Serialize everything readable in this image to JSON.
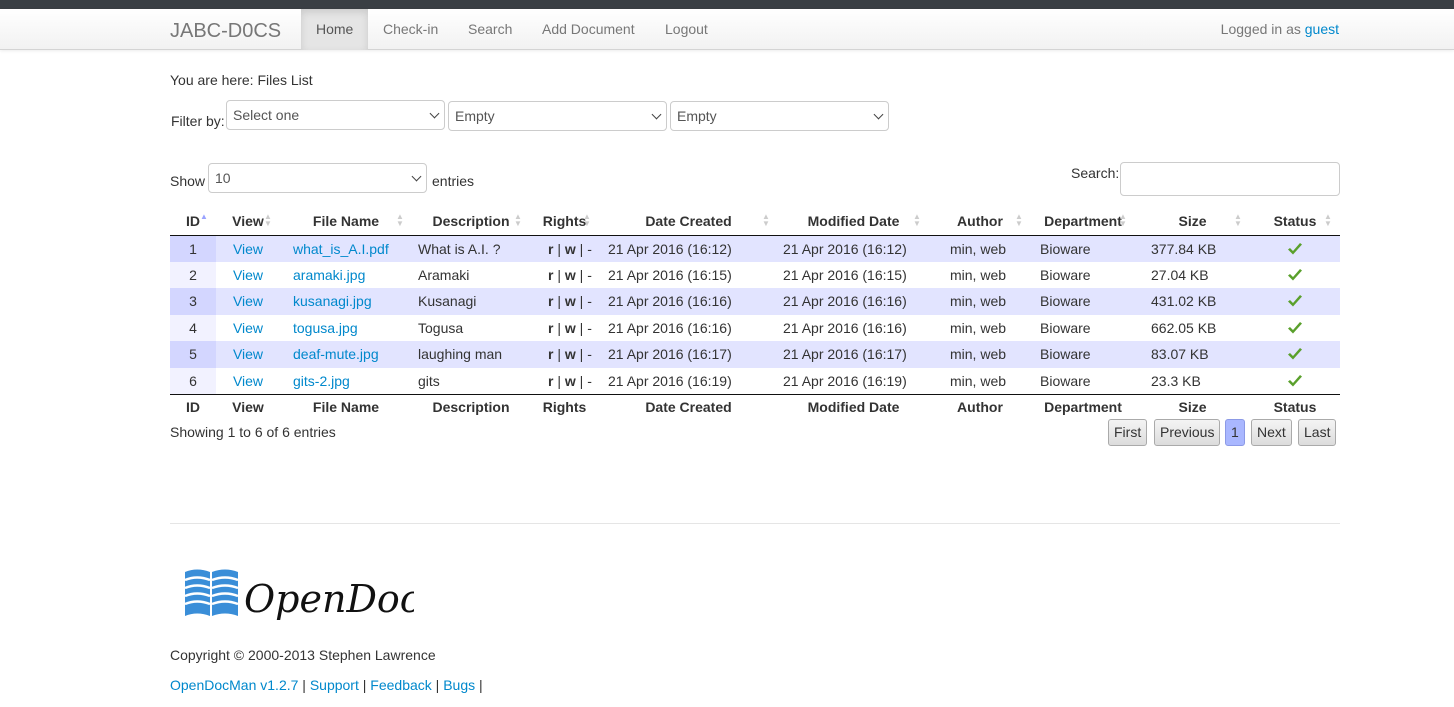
{
  "nav": {
    "brand": "JABC-D0CS",
    "items": [
      "Home",
      "Check-in",
      "Search",
      "Add Document",
      "Logout"
    ],
    "logged_prefix": "Logged in as",
    "user": "guest"
  },
  "breadcrumb": "You are here: Files List",
  "filter": {
    "label": "Filter by:",
    "selects": [
      "Select one",
      "Empty",
      "Empty"
    ]
  },
  "length": {
    "show": "Show",
    "value": "10",
    "entries": "entries"
  },
  "search": {
    "label": "Search:",
    "value": ""
  },
  "table": {
    "columns": [
      "ID",
      "View",
      "File Name",
      "Description",
      "Rights",
      "Date Created",
      "Modified Date",
      "Author",
      "Department",
      "Size",
      "Status"
    ],
    "rows": [
      {
        "id": "1",
        "view": "View",
        "file": "what_is_A.I.pdf",
        "desc": "What is A.I. ?",
        "rights": [
          "r",
          "w",
          "-"
        ],
        "created": "21 Apr 2016 (16:12)",
        "modified": "21 Apr 2016 (16:12)",
        "author": "min, web",
        "dept": "Bioware",
        "size": "377.84 KB",
        "status": "check-icon"
      },
      {
        "id": "2",
        "view": "View",
        "file": "aramaki.jpg",
        "desc": "Aramaki",
        "rights": [
          "r",
          "w",
          "-"
        ],
        "created": "21 Apr 2016 (16:15)",
        "modified": "21 Apr 2016 (16:15)",
        "author": "min, web",
        "dept": "Bioware",
        "size": "27.04 KB",
        "status": "check-icon"
      },
      {
        "id": "3",
        "view": "View",
        "file": "kusanagi.jpg",
        "desc": "Kusanagi",
        "rights": [
          "r",
          "w",
          "-"
        ],
        "created": "21 Apr 2016 (16:16)",
        "modified": "21 Apr 2016 (16:16)",
        "author": "min, web",
        "dept": "Bioware",
        "size": "431.02 KB",
        "status": "check-icon"
      },
      {
        "id": "4",
        "view": "View",
        "file": "togusa.jpg",
        "desc": "Togusa",
        "rights": [
          "r",
          "w",
          "-"
        ],
        "created": "21 Apr 2016 (16:16)",
        "modified": "21 Apr 2016 (16:16)",
        "author": "min, web",
        "dept": "Bioware",
        "size": "662.05 KB",
        "status": "check-icon"
      },
      {
        "id": "5",
        "view": "View",
        "file": "deaf-mute.jpg",
        "desc": "laughing man",
        "rights": [
          "r",
          "w",
          "-"
        ],
        "created": "21 Apr 2016 (16:17)",
        "modified": "21 Apr 2016 (16:17)",
        "author": "min, web",
        "dept": "Bioware",
        "size": "83.07 KB",
        "status": "check-icon"
      },
      {
        "id": "6",
        "view": "View",
        "file": "gits-2.jpg",
        "desc": "gits",
        "rights": [
          "r",
          "w",
          "-"
        ],
        "created": "21 Apr 2016 (16:19)",
        "modified": "21 Apr 2016 (16:19)",
        "author": "min, web",
        "dept": "Bioware",
        "size": "23.3 KB",
        "status": "check-icon"
      }
    ]
  },
  "info": "Showing 1 to 6 of 6 entries",
  "pagination": {
    "first": "First",
    "previous": "Previous",
    "current": "1",
    "next": "Next",
    "last": "Last"
  },
  "footer": {
    "logo_text": "OpenDocMan",
    "copyright": "Copyright © 2000-2013 Stephen Lawrence",
    "links": [
      "OpenDocMan v1.2.7",
      "Support",
      "Feedback",
      "Bugs"
    ]
  },
  "colors": {
    "accent": "#0088cc",
    "row_odd": "#e2e4ff",
    "check": "#5aa02c"
  }
}
